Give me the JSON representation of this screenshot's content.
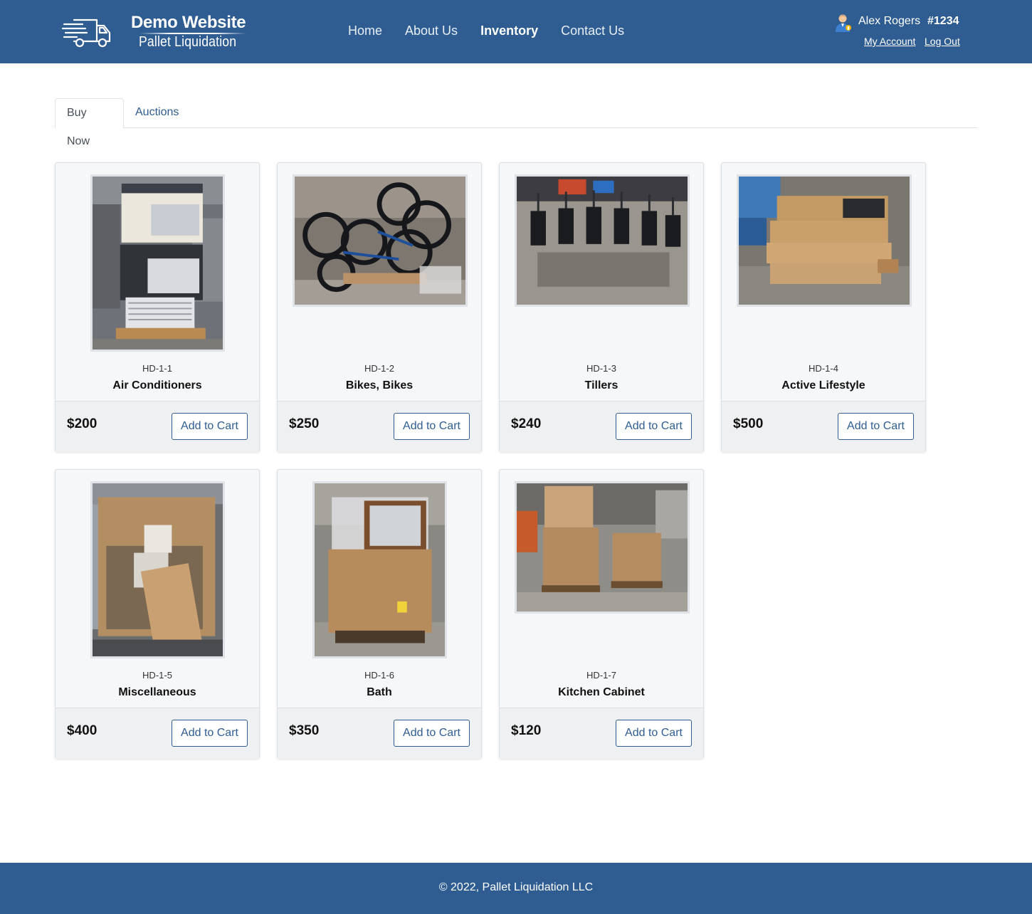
{
  "header": {
    "logo_title": "Demo Website",
    "logo_subtitle": "Pallet Liquidation",
    "nav": [
      {
        "label": "Home"
      },
      {
        "label": "About Us"
      },
      {
        "label": "Inventory"
      },
      {
        "label": "Contact Us"
      }
    ],
    "active_nav": "Inventory",
    "user": {
      "name": "Alex Rogers",
      "id": "#1234",
      "my_account": "My Account",
      "log_out": "Log Out"
    }
  },
  "tabs": [
    {
      "label": "Buy Now",
      "active": true
    },
    {
      "label": "Auctions",
      "active": false
    }
  ],
  "products": [
    {
      "sku": "HD-1-1",
      "title": "Air Conditioners",
      "price": "$200",
      "button": "Add to Cart",
      "image_icon": "air-conditioner-pallet-image"
    },
    {
      "sku": "HD-1-2",
      "title": "Bikes, Bikes",
      "price": "$250",
      "button": "Add to Cart",
      "image_icon": "bikes-pallet-image"
    },
    {
      "sku": "HD-1-3",
      "title": "Tillers",
      "price": "$240",
      "button": "Add to Cart",
      "image_icon": "tillers-image"
    },
    {
      "sku": "HD-1-4",
      "title": "Active Lifestyle",
      "price": "$500",
      "button": "Add to Cart",
      "image_icon": "boxes-pallet-image"
    },
    {
      "sku": "HD-1-5",
      "title": "Miscellaneous",
      "price": "$400",
      "button": "Add to Cart",
      "image_icon": "misc-gaylord-image"
    },
    {
      "sku": "HD-1-6",
      "title": "Bath",
      "price": "$350",
      "button": "Add to Cart",
      "image_icon": "bath-pallet-image"
    },
    {
      "sku": "HD-1-7",
      "title": "Kitchen Cabinet",
      "price": "$120",
      "button": "Add to Cart",
      "image_icon": "kitchen-cabinet-pallets-image"
    }
  ],
  "footer": {
    "text": "© 2022, Pallet Liquidation LLC"
  },
  "colors": {
    "brand": "#2f5d91",
    "card_bg": "#f6f7f9",
    "footer_bg": "#2f5d91"
  }
}
